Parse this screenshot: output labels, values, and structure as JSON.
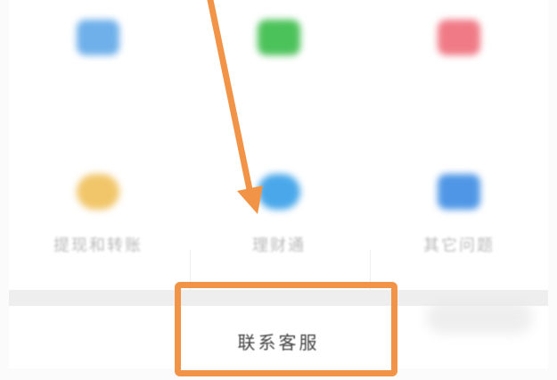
{
  "services": [
    {
      "label": "",
      "icon": "card-icon",
      "color": "#6fb0ea"
    },
    {
      "label": "",
      "icon": "wallet-icon",
      "color": "#4cc25a"
    },
    {
      "label": "",
      "icon": "heart-icon",
      "color": "#f07b86"
    },
    {
      "label": "提现和转账",
      "icon": "transfer-icon",
      "color": "#f1c66a"
    },
    {
      "label": "理财通",
      "icon": "licaitong-icon",
      "color": "#4aa8ea"
    },
    {
      "label": "其它问题",
      "icon": "question-icon",
      "color": "#4f97e6"
    }
  ],
  "contact": {
    "label": "联系客服"
  },
  "annotation": {
    "color": "#f29447"
  }
}
